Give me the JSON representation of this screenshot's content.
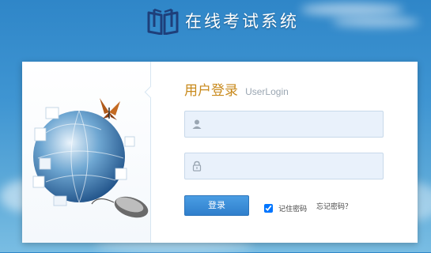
{
  "header": {
    "title": "在线考试系统",
    "logo_icon": "open-book-icon"
  },
  "login": {
    "title": "用户登录",
    "subtitle": "UserLogin",
    "username": {
      "icon": "user-icon",
      "value": "",
      "placeholder": ""
    },
    "password": {
      "icon": "lock-icon",
      "value": "",
      "placeholder": ""
    },
    "submit_label": "登录",
    "remember_label": "记住密码",
    "remember_checked": true,
    "forgot_label": "忘记密码？"
  },
  "illustration": {
    "description_icons": [
      "puzzle-globe-icon",
      "butterfly-icon",
      "computer-mouse-icon"
    ]
  },
  "colors": {
    "accent_blue": "#3a8cd8",
    "title_gold": "#c8891b",
    "field_bg": "#e9f1fb"
  }
}
